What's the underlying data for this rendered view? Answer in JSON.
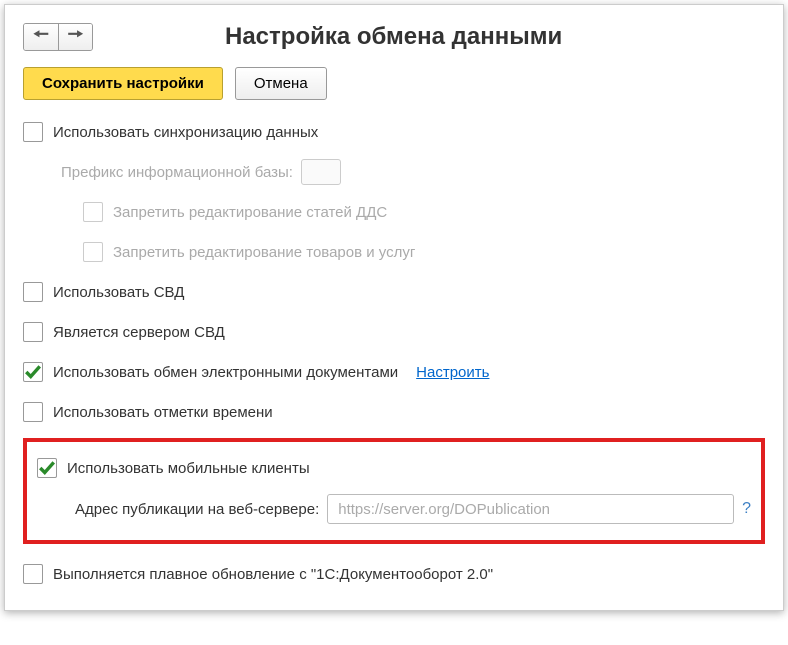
{
  "header": {
    "title": "Настройка обмена данными"
  },
  "toolbar": {
    "save_label": "Сохранить настройки",
    "cancel_label": "Отмена"
  },
  "fields": {
    "use_sync": {
      "label": "Использовать синхронизацию данных",
      "checked": false
    },
    "prefix": {
      "label": "Префикс информационной базы:",
      "value": ""
    },
    "forbid_dds": {
      "label": "Запретить редактирование статей ДДС",
      "checked": false
    },
    "forbid_goods": {
      "label": "Запретить редактирование товаров и услуг",
      "checked": false
    },
    "use_svd": {
      "label": "Использовать СВД",
      "checked": false
    },
    "is_svd_server": {
      "label": "Является сервером СВД",
      "checked": false
    },
    "use_edo": {
      "label": "Использовать обмен электронными документами",
      "checked": true,
      "link": "Настроить"
    },
    "use_timestamps": {
      "label": "Использовать отметки времени",
      "checked": false
    },
    "use_mobile": {
      "label": "Использовать мобильные клиенты",
      "checked": true
    },
    "publish_address": {
      "label": "Адрес публикации на веб-сервере:",
      "placeholder": "https://server.org/DOPublication",
      "value": ""
    },
    "smooth_update": {
      "label": "Выполняется плавное обновление с \"1С:Документооборот 2.0\"",
      "checked": false
    },
    "help": "?"
  }
}
